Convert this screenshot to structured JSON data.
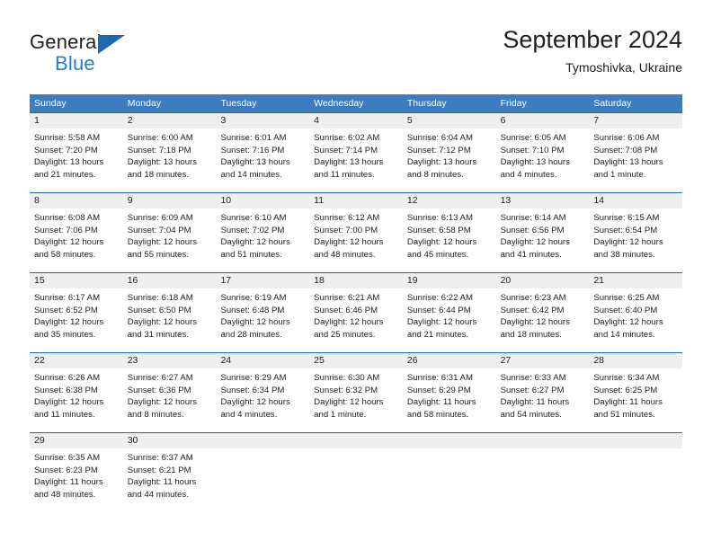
{
  "brand": {
    "line1": "General",
    "line2": "Blue",
    "triangle_color": "#1f68ad",
    "blue_color": "#1f7fd4"
  },
  "header": {
    "title": "September 2024",
    "subtitle": "Tymoshivka, Ukraine"
  },
  "theme": {
    "header_bg": "#3b7dbf",
    "row_divider": "#1f68ad",
    "day_number_bg": "#efefef",
    "text": "#231f20"
  },
  "weekdays": [
    "Sunday",
    "Monday",
    "Tuesday",
    "Wednesday",
    "Thursday",
    "Friday",
    "Saturday"
  ],
  "weeks": [
    [
      {
        "day": "1",
        "sunrise": "Sunrise: 5:58 AM",
        "sunset": "Sunset: 7:20 PM",
        "daylight1": "Daylight: 13 hours",
        "daylight2": "and 21 minutes."
      },
      {
        "day": "2",
        "sunrise": "Sunrise: 6:00 AM",
        "sunset": "Sunset: 7:18 PM",
        "daylight1": "Daylight: 13 hours",
        "daylight2": "and 18 minutes."
      },
      {
        "day": "3",
        "sunrise": "Sunrise: 6:01 AM",
        "sunset": "Sunset: 7:16 PM",
        "daylight1": "Daylight: 13 hours",
        "daylight2": "and 14 minutes."
      },
      {
        "day": "4",
        "sunrise": "Sunrise: 6:02 AM",
        "sunset": "Sunset: 7:14 PM",
        "daylight1": "Daylight: 13 hours",
        "daylight2": "and 11 minutes."
      },
      {
        "day": "5",
        "sunrise": "Sunrise: 6:04 AM",
        "sunset": "Sunset: 7:12 PM",
        "daylight1": "Daylight: 13 hours",
        "daylight2": "and 8 minutes."
      },
      {
        "day": "6",
        "sunrise": "Sunrise: 6:05 AM",
        "sunset": "Sunset: 7:10 PM",
        "daylight1": "Daylight: 13 hours",
        "daylight2": "and 4 minutes."
      },
      {
        "day": "7",
        "sunrise": "Sunrise: 6:06 AM",
        "sunset": "Sunset: 7:08 PM",
        "daylight1": "Daylight: 13 hours",
        "daylight2": "and 1 minute."
      }
    ],
    [
      {
        "day": "8",
        "sunrise": "Sunrise: 6:08 AM",
        "sunset": "Sunset: 7:06 PM",
        "daylight1": "Daylight: 12 hours",
        "daylight2": "and 58 minutes."
      },
      {
        "day": "9",
        "sunrise": "Sunrise: 6:09 AM",
        "sunset": "Sunset: 7:04 PM",
        "daylight1": "Daylight: 12 hours",
        "daylight2": "and 55 minutes."
      },
      {
        "day": "10",
        "sunrise": "Sunrise: 6:10 AM",
        "sunset": "Sunset: 7:02 PM",
        "daylight1": "Daylight: 12 hours",
        "daylight2": "and 51 minutes."
      },
      {
        "day": "11",
        "sunrise": "Sunrise: 6:12 AM",
        "sunset": "Sunset: 7:00 PM",
        "daylight1": "Daylight: 12 hours",
        "daylight2": "and 48 minutes."
      },
      {
        "day": "12",
        "sunrise": "Sunrise: 6:13 AM",
        "sunset": "Sunset: 6:58 PM",
        "daylight1": "Daylight: 12 hours",
        "daylight2": "and 45 minutes."
      },
      {
        "day": "13",
        "sunrise": "Sunrise: 6:14 AM",
        "sunset": "Sunset: 6:56 PM",
        "daylight1": "Daylight: 12 hours",
        "daylight2": "and 41 minutes."
      },
      {
        "day": "14",
        "sunrise": "Sunrise: 6:15 AM",
        "sunset": "Sunset: 6:54 PM",
        "daylight1": "Daylight: 12 hours",
        "daylight2": "and 38 minutes."
      }
    ],
    [
      {
        "day": "15",
        "sunrise": "Sunrise: 6:17 AM",
        "sunset": "Sunset: 6:52 PM",
        "daylight1": "Daylight: 12 hours",
        "daylight2": "and 35 minutes."
      },
      {
        "day": "16",
        "sunrise": "Sunrise: 6:18 AM",
        "sunset": "Sunset: 6:50 PM",
        "daylight1": "Daylight: 12 hours",
        "daylight2": "and 31 minutes."
      },
      {
        "day": "17",
        "sunrise": "Sunrise: 6:19 AM",
        "sunset": "Sunset: 6:48 PM",
        "daylight1": "Daylight: 12 hours",
        "daylight2": "and 28 minutes."
      },
      {
        "day": "18",
        "sunrise": "Sunrise: 6:21 AM",
        "sunset": "Sunset: 6:46 PM",
        "daylight1": "Daylight: 12 hours",
        "daylight2": "and 25 minutes."
      },
      {
        "day": "19",
        "sunrise": "Sunrise: 6:22 AM",
        "sunset": "Sunset: 6:44 PM",
        "daylight1": "Daylight: 12 hours",
        "daylight2": "and 21 minutes."
      },
      {
        "day": "20",
        "sunrise": "Sunrise: 6:23 AM",
        "sunset": "Sunset: 6:42 PM",
        "daylight1": "Daylight: 12 hours",
        "daylight2": "and 18 minutes."
      },
      {
        "day": "21",
        "sunrise": "Sunrise: 6:25 AM",
        "sunset": "Sunset: 6:40 PM",
        "daylight1": "Daylight: 12 hours",
        "daylight2": "and 14 minutes."
      }
    ],
    [
      {
        "day": "22",
        "sunrise": "Sunrise: 6:26 AM",
        "sunset": "Sunset: 6:38 PM",
        "daylight1": "Daylight: 12 hours",
        "daylight2": "and 11 minutes."
      },
      {
        "day": "23",
        "sunrise": "Sunrise: 6:27 AM",
        "sunset": "Sunset: 6:36 PM",
        "daylight1": "Daylight: 12 hours",
        "daylight2": "and 8 minutes."
      },
      {
        "day": "24",
        "sunrise": "Sunrise: 6:29 AM",
        "sunset": "Sunset: 6:34 PM",
        "daylight1": "Daylight: 12 hours",
        "daylight2": "and 4 minutes."
      },
      {
        "day": "25",
        "sunrise": "Sunrise: 6:30 AM",
        "sunset": "Sunset: 6:32 PM",
        "daylight1": "Daylight: 12 hours",
        "daylight2": "and 1 minute."
      },
      {
        "day": "26",
        "sunrise": "Sunrise: 6:31 AM",
        "sunset": "Sunset: 6:29 PM",
        "daylight1": "Daylight: 11 hours",
        "daylight2": "and 58 minutes."
      },
      {
        "day": "27",
        "sunrise": "Sunrise: 6:33 AM",
        "sunset": "Sunset: 6:27 PM",
        "daylight1": "Daylight: 11 hours",
        "daylight2": "and 54 minutes."
      },
      {
        "day": "28",
        "sunrise": "Sunrise: 6:34 AM",
        "sunset": "Sunset: 6:25 PM",
        "daylight1": "Daylight: 11 hours",
        "daylight2": "and 51 minutes."
      }
    ],
    [
      {
        "day": "29",
        "sunrise": "Sunrise: 6:35 AM",
        "sunset": "Sunset: 6:23 PM",
        "daylight1": "Daylight: 11 hours",
        "daylight2": "and 48 minutes."
      },
      {
        "day": "30",
        "sunrise": "Sunrise: 6:37 AM",
        "sunset": "Sunset: 6:21 PM",
        "daylight1": "Daylight: 11 hours",
        "daylight2": "and 44 minutes."
      },
      {
        "day": "",
        "sunrise": "",
        "sunset": "",
        "daylight1": "",
        "daylight2": ""
      },
      {
        "day": "",
        "sunrise": "",
        "sunset": "",
        "daylight1": "",
        "daylight2": ""
      },
      {
        "day": "",
        "sunrise": "",
        "sunset": "",
        "daylight1": "",
        "daylight2": ""
      },
      {
        "day": "",
        "sunrise": "",
        "sunset": "",
        "daylight1": "",
        "daylight2": ""
      },
      {
        "day": "",
        "sunrise": "",
        "sunset": "",
        "daylight1": "",
        "daylight2": ""
      }
    ]
  ]
}
